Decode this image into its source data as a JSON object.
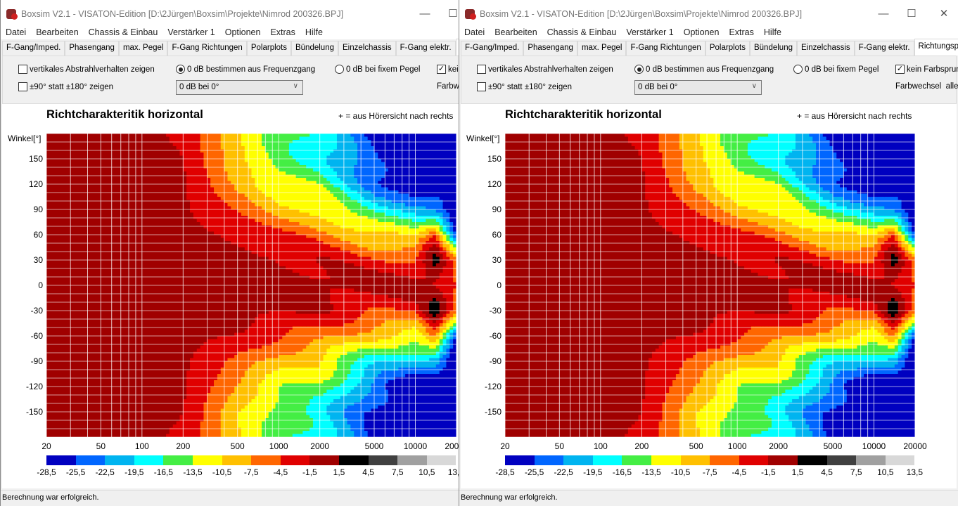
{
  "window": {
    "title": "Boxsim V2.1 - VISATON-Edition [D:\\2Jürgen\\Boxsim\\Projekte\\Nimrod 200326.BPJ]",
    "menu": [
      "Datei",
      "Bearbeiten",
      "Chassis & Einbau",
      "Verstärker 1",
      "Optionen",
      "Extras",
      "Hilfe"
    ],
    "tabs": [
      "F-Gang/Imped.",
      "Phasengang",
      "max. Pegel",
      "F-Gang Richtungen",
      "Polarplots",
      "Bündelung",
      "Einzelchassis",
      "F-Gang elektr.",
      "Richtungsplots"
    ],
    "options": {
      "vertical": "vertikales Abstrahlverhalten zeigen",
      "ninety": "±90° statt ±180° zeigen",
      "radio_freq": "0 dB bestimmen aus Frequenzgang",
      "radio_fixed": "0 dB bei fixem Pegel",
      "no_jump": "kein Farbsprung",
      "color_change": "Farbwechsel  alle",
      "dropdown_value": "0 dB bei 0°"
    },
    "status": "Berechnung war erfolgreich."
  },
  "chart_data": {
    "type": "heatmap",
    "title": "Richtcharakteritik horizontal",
    "note": "+ = aus Hörersicht nach rechts",
    "ylabel": "Winkel[°]",
    "ylim": [
      -180,
      180
    ],
    "xlim": [
      20,
      20000
    ],
    "xscale": "log",
    "yticks": [
      "150",
      "120",
      "90",
      "60",
      "30",
      "0",
      "-30",
      "-60",
      "-90",
      "-120",
      "-150"
    ],
    "xticks": [
      "20",
      "50",
      "100",
      "200",
      "500",
      "1000",
      "2000",
      "5000",
      "10000",
      "20000"
    ],
    "sample_freqs": [
      20,
      100,
      200,
      300,
      500,
      1000,
      2000,
      5000,
      10000,
      14000,
      20000
    ],
    "sample_angles_abs": [
      0,
      30,
      60,
      90,
      120,
      150,
      180
    ],
    "levels_db": [
      [
        0,
        0,
        0,
        0,
        0,
        0,
        0,
        0,
        0,
        -1,
        -3
      ],
      [
        0,
        0,
        0,
        0,
        0,
        -1,
        -2,
        -4,
        -4,
        3,
        -8
      ],
      [
        0,
        0,
        0,
        -1,
        -2,
        -4,
        -6,
        -10,
        -12,
        -5,
        -25
      ],
      [
        0,
        0,
        -1,
        -3,
        -5,
        -9,
        -11,
        -18,
        -20,
        -22,
        -30
      ],
      [
        0,
        0,
        -1,
        -4,
        -8,
        -13,
        -14,
        -24,
        -30,
        -30,
        -30
      ],
      [
        0,
        0,
        -1.5,
        -5,
        -10,
        -15,
        -18,
        -26,
        -30,
        -30,
        -30
      ],
      [
        0,
        -1,
        -2,
        -6,
        -10,
        -15,
        -18,
        -26,
        -30,
        -30,
        -30
      ]
    ],
    "colorscale": {
      "labels": [
        "-28,5",
        "-25,5",
        "-22,5",
        "-19,5",
        "-16,5",
        "-13,5",
        "-10,5",
        "-7,5",
        "-4,5",
        "-1,5",
        "1,5",
        "4,5",
        "7,5",
        "10,5",
        "13,5"
      ],
      "bounds": [
        -28.5,
        -25.5,
        -22.5,
        -19.5,
        -16.5,
        -13.5,
        -10.5,
        -7.5,
        -4.5,
        -1.5,
        1.5,
        4.5,
        7.5,
        10.5,
        13.5
      ],
      "colors": [
        "#0000c0",
        "#0066ff",
        "#00b4f0",
        "#00ffff",
        "#44ee44",
        "#ffff00",
        "#ffc000",
        "#ff6600",
        "#e00000",
        "#a00000",
        "#000000",
        "#404040",
        "#a0a0a0",
        "#d8d8d8"
      ]
    }
  }
}
